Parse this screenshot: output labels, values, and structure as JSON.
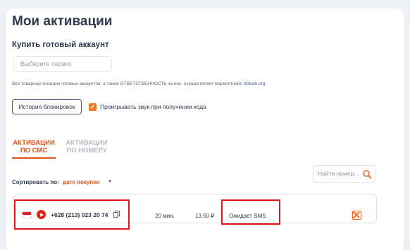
{
  "page": {
    "title": "Мои активации",
    "subtitle": "Купить готовый аккаунт",
    "service_placeholder": "Выберите сервис",
    "disclaimer_text": "Все товарные позиции готовых аккаунтов, а также ОТВЕТСТВЕННОСТЬ за них, осуществляет маркетплейс ",
    "disclaimer_link": "hStock.org",
    "history_button": "История блокировок",
    "sound_option": "Проигрывать звук при получении кода",
    "sound_checked": true
  },
  "tabs": [
    {
      "line1": "АКТИВАЦИИ",
      "line2": "ПО СМС",
      "active": true
    },
    {
      "line1": "АКТИВАЦИИ",
      "line2": "ПО НОМЕРУ",
      "active": false
    }
  ],
  "sort": {
    "label": "Сортировать по:",
    "value": "дате покупки"
  },
  "search": {
    "placeholder": "Найти номер..."
  },
  "activation": {
    "country_flag": "indonesia-flag",
    "service_icon": "youtube-icon",
    "phone": "+628 (213) 023 20 74",
    "duration": "20 мин.",
    "price": "13.50 ₽",
    "status": "Ожидает SMS"
  },
  "colors": {
    "accent": "#e0531a",
    "highlight": "#e0141a",
    "checkbox": "#ef7a2a"
  }
}
